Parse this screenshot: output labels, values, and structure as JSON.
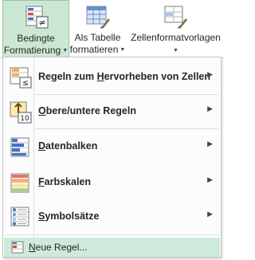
{
  "ribbon": {
    "buttons": [
      {
        "label_line1": "Bedingte",
        "label_line2": "Formatierung",
        "active": true
      },
      {
        "label_line1": "Als Tabelle",
        "label_line2": "formatieren",
        "active": false
      },
      {
        "label_line1": "Zellenformatvorlagen",
        "label_line2": "",
        "active": false
      }
    ]
  },
  "menu": {
    "items": [
      {
        "pre": "Regeln zum ",
        "key": "H",
        "post": "ervorheben von Zellen",
        "icon": "highlight-cells-icon",
        "submenu": true
      },
      {
        "pre": "",
        "key": "O",
        "post": "bere/untere Regeln",
        "icon": "top-bottom-rules-icon",
        "submenu": true
      },
      {
        "pre": "",
        "key": "D",
        "post": "atenbalken",
        "icon": "data-bars-icon",
        "submenu": true
      },
      {
        "pre": "",
        "key": "F",
        "post": "arbskalen",
        "icon": "color-scales-icon",
        "submenu": true
      },
      {
        "pre": "",
        "key": "S",
        "post": "ymbolsätze",
        "icon": "icon-sets-icon",
        "submenu": true
      }
    ],
    "new_rule": {
      "key": "N",
      "post": "eue Regel...",
      "icon": "new-rule-icon"
    },
    "submenu_arrow": "▶"
  },
  "colors": {
    "active_bg": "#cce8d4",
    "hover_bg": "#cfeadb",
    "accent_green": "#217346"
  }
}
